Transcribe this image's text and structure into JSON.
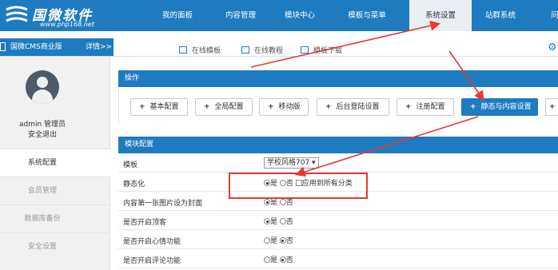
{
  "header": {
    "logo_title": "国微软件",
    "logo_url": "www.php168.net",
    "nav": [
      {
        "label": "我的面板",
        "active": false
      },
      {
        "label": "内容管理",
        "active": false
      },
      {
        "label": "模块中心",
        "active": false
      },
      {
        "label": "模板与菜单",
        "active": false
      },
      {
        "label": "系统设置",
        "active": true
      },
      {
        "label": "站群系统",
        "active": false
      },
      {
        "label": "问",
        "active": false
      }
    ]
  },
  "subbar": {
    "version": "国微CMS商业版",
    "details": "详情>>",
    "links": [
      "在线模板",
      "在线教程",
      "模板下载"
    ]
  },
  "sidebar": {
    "user_name": "admin 管理员",
    "logout": "安全退出",
    "items": [
      "系统配置",
      "会员管理",
      "数据库备份",
      "安全设置"
    ]
  },
  "ops": {
    "title": "操作",
    "buttons": [
      "基本配置",
      "全局配置",
      "移动版",
      "后台登陆设置",
      "注册配置",
      "静态与内容设置"
    ]
  },
  "module_config": {
    "title": "模块配置",
    "rows": [
      {
        "label": "模板",
        "select": "学校风格707"
      },
      {
        "label": "静态化",
        "yes": "是",
        "no": "否",
        "selected": "是",
        "extra": "应用到所有分类"
      },
      {
        "label": "内容第一张图片设为封面",
        "yes": "是",
        "no": "否",
        "selected": "是"
      },
      {
        "label": "是否开启顶客",
        "yes": "是",
        "no": "否",
        "selected": "是"
      },
      {
        "label": "是否开启心情功能",
        "yes": "是",
        "no": "否",
        "selected": "否"
      },
      {
        "label": "是否开启评论功能",
        "yes": "是",
        "no": "否",
        "selected": "否"
      }
    ]
  },
  "colors": {
    "primary": "#1e7bc0",
    "annotation": "#e53935"
  }
}
